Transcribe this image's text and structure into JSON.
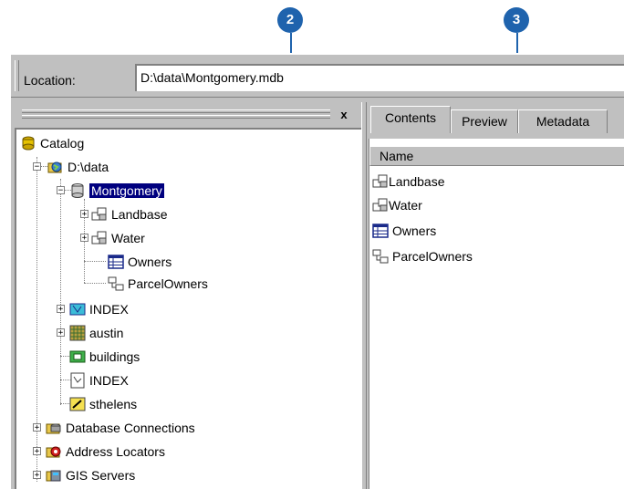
{
  "callouts": {
    "c2": "2",
    "c3": "3"
  },
  "location": {
    "label": "Location:",
    "value": "D:\\data\\Montgomery.mdb"
  },
  "tree": {
    "close": "x",
    "items": [
      {
        "label": "Catalog",
        "icon": "catalog-icon"
      },
      {
        "label": "D:\\data",
        "icon": "folder-connection-icon"
      },
      {
        "label": "Montgomery",
        "icon": "database-icon"
      },
      {
        "label": "Landbase",
        "icon": "feature-dataset-icon"
      },
      {
        "label": "Water",
        "icon": "feature-dataset-icon"
      },
      {
        "label": "Owners",
        "icon": "table-icon"
      },
      {
        "label": "ParcelOwners",
        "icon": "relationship-class-icon"
      },
      {
        "label": "INDEX",
        "icon": "coverage-icon"
      },
      {
        "label": "austin",
        "icon": "raster-icon"
      },
      {
        "label": "buildings",
        "icon": "shapefile-icon"
      },
      {
        "label": "INDEX",
        "icon": "feature-class-icon"
      },
      {
        "label": "sthelens",
        "icon": "layer-icon"
      },
      {
        "label": "Database Connections",
        "icon": "database-connections-icon"
      },
      {
        "label": "Address Locators",
        "icon": "address-locators-icon"
      },
      {
        "label": "GIS Servers",
        "icon": "gis-servers-icon"
      }
    ]
  },
  "tabs": [
    {
      "label": "Contents"
    },
    {
      "label": "Preview"
    },
    {
      "label": "Metadata"
    }
  ],
  "contents": {
    "header": "Name",
    "items": [
      {
        "label": "Landbase",
        "icon": "feature-dataset-icon"
      },
      {
        "label": "Water",
        "icon": "feature-dataset-icon"
      },
      {
        "label": "Owners",
        "icon": "table-icon"
      },
      {
        "label": "ParcelOwners",
        "icon": "relationship-class-icon"
      }
    ]
  }
}
